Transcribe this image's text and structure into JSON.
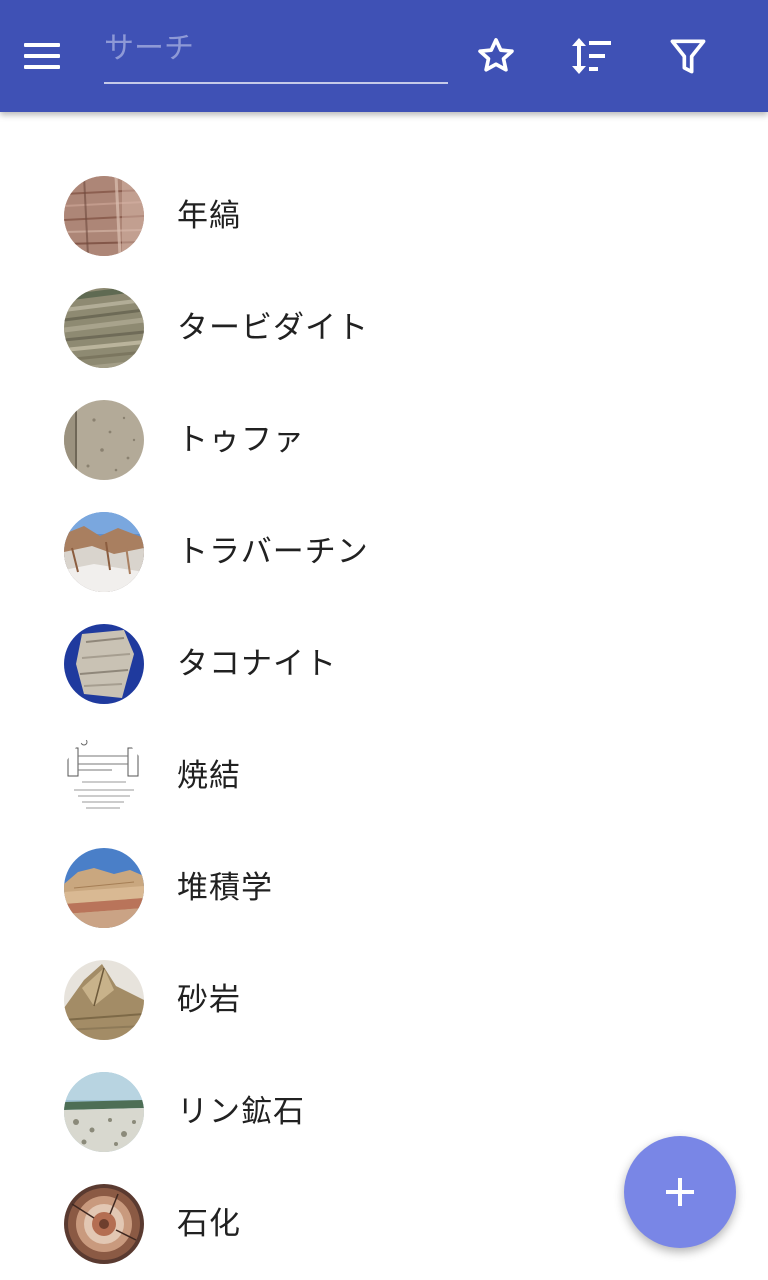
{
  "toolbar": {
    "menu_icon": "hamburger-menu-icon",
    "search": {
      "placeholder": "サーチ",
      "value": ""
    },
    "actions": [
      {
        "icon": "star-outline-icon"
      },
      {
        "icon": "sort-icon"
      },
      {
        "icon": "filter-icon"
      }
    ]
  },
  "list": {
    "items": [
      {
        "label": "年縞"
      },
      {
        "label": "タービダイト"
      },
      {
        "label": "トゥファ"
      },
      {
        "label": "トラバーチン"
      },
      {
        "label": "タコナイト"
      },
      {
        "label": "焼結"
      },
      {
        "label": "堆積学"
      },
      {
        "label": "砂岩"
      },
      {
        "label": "リン鉱石"
      },
      {
        "label": "石化"
      }
    ]
  },
  "fab": {
    "icon": "plus-icon"
  },
  "colors": {
    "toolbar": "#3f51b5",
    "fab": "#7986e6",
    "text": "#212121",
    "background": "#ffffff"
  }
}
